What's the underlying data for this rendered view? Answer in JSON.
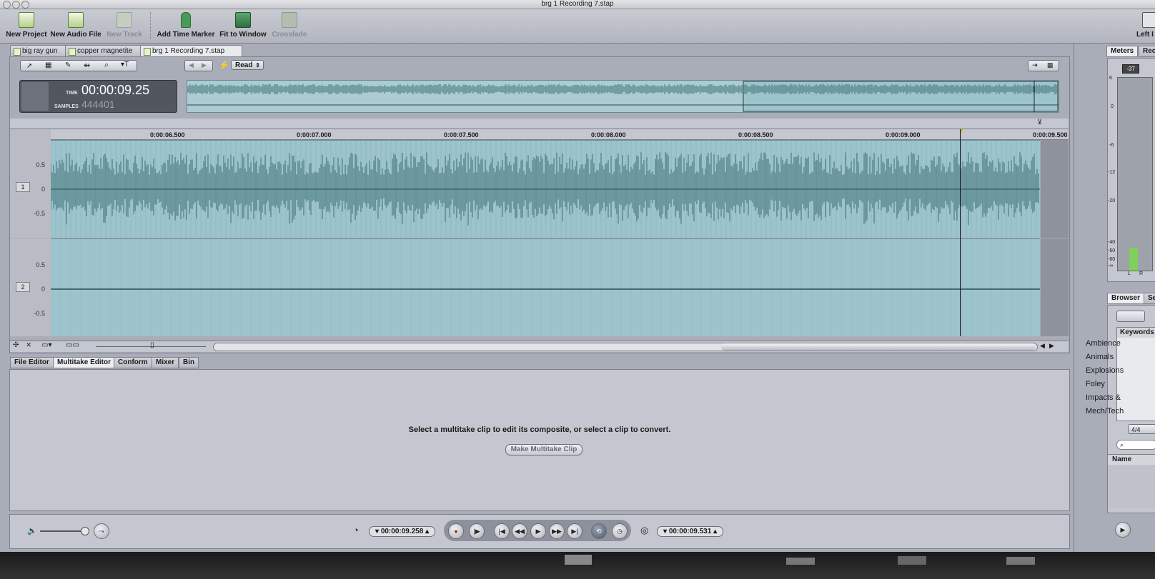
{
  "window": {
    "title": "brg 1 Recording 7.stap"
  },
  "toolbar": {
    "items": [
      {
        "label": "New Project",
        "icon": "new-project-icon",
        "enabled": true
      },
      {
        "label": "New Audio File",
        "icon": "new-audio-file-icon",
        "enabled": true
      },
      {
        "label": "New Track",
        "icon": "new-track-icon",
        "enabled": false
      },
      {
        "label": "Add Time Marker",
        "icon": "add-time-marker-icon",
        "enabled": true
      },
      {
        "label": "Fit to Window",
        "icon": "fit-to-window-icon",
        "enabled": true
      },
      {
        "label": "Crossfade",
        "icon": "crossfade-icon",
        "enabled": false
      }
    ],
    "right_label": "Left I"
  },
  "doc_tabs": [
    "big ray gun",
    "copper magnetite",
    "brg 1 Recording 7.stap"
  ],
  "automation_mode": "Read",
  "timecode": {
    "time_label": "TIME",
    "time": "00:00:09.25",
    "samples_label": "SAMPLES",
    "samples": "444401"
  },
  "ruler_labels": [
    "0:00:06.500",
    "0:00:07.000",
    "0:00:07.500",
    "0:00:08.000",
    "0:00:08.500",
    "0:00:09.000",
    "0:00:09.500"
  ],
  "tracks": [
    {
      "number": "1",
      "y_labels": [
        "0.5",
        "0",
        "-0.5"
      ]
    },
    {
      "number": "2",
      "y_labels": [
        "0.5",
        "0",
        "-0.5"
      ]
    }
  ],
  "bottom_tabs": [
    "File Editor",
    "Multitake Editor",
    "Conform",
    "Mixer",
    "Bin"
  ],
  "multitake": {
    "message": "Select a multitake clip to edit its composite, or select a clip to convert.",
    "button": "Make Multitake Clip"
  },
  "transport": {
    "playhead_tc": "00:00:09.258",
    "end_tc": "00:00:09.531"
  },
  "meters": {
    "tab": "Meters",
    "tab2": "Rec",
    "peak": "-37",
    "scale": [
      "6",
      "0",
      "-6",
      "-12",
      "-20",
      "-40",
      "-50",
      "-60",
      "-∞"
    ],
    "channels": [
      "L",
      "R"
    ],
    "level_fraction": 0.12
  },
  "browser": {
    "tabs": [
      "Browser",
      "Se"
    ],
    "keywords_header": "Keywords",
    "keywords": [
      "Ambience",
      "Animals",
      "Explosions",
      "Foley",
      "Impacts &",
      "Mech/Tech"
    ],
    "time_sig": "4/4",
    "name_header": "Name"
  },
  "colors": {
    "track_bg": "#9dc4cc",
    "waveform": "#3c6e74",
    "meter_green": "#7fd15a"
  }
}
